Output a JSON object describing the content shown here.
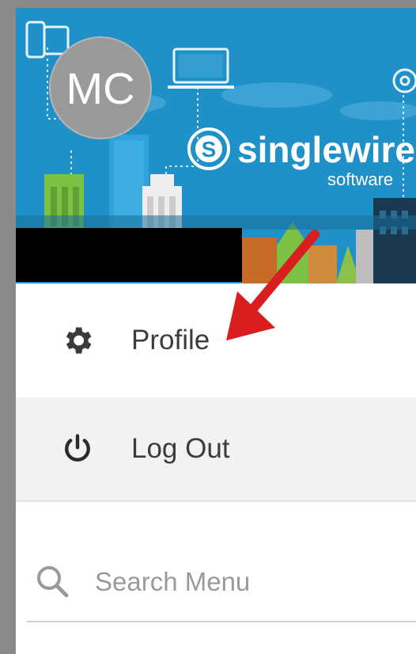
{
  "header": {
    "avatar_initials": "MC",
    "brand_name": "singlewire",
    "brand_subtitle": "software"
  },
  "menu": {
    "items": [
      {
        "label": "Profile",
        "icon": "gear-icon"
      },
      {
        "label": "Log Out",
        "icon": "power-icon"
      }
    ]
  },
  "search": {
    "placeholder": "Search Menu",
    "value": "",
    "icon": "search-icon"
  },
  "colors": {
    "banner_blue": "#1f90c8",
    "avatar_gray": "#9a9a9a",
    "annotation_red": "#d81e1e",
    "hover_row": "#f2f2f2"
  }
}
